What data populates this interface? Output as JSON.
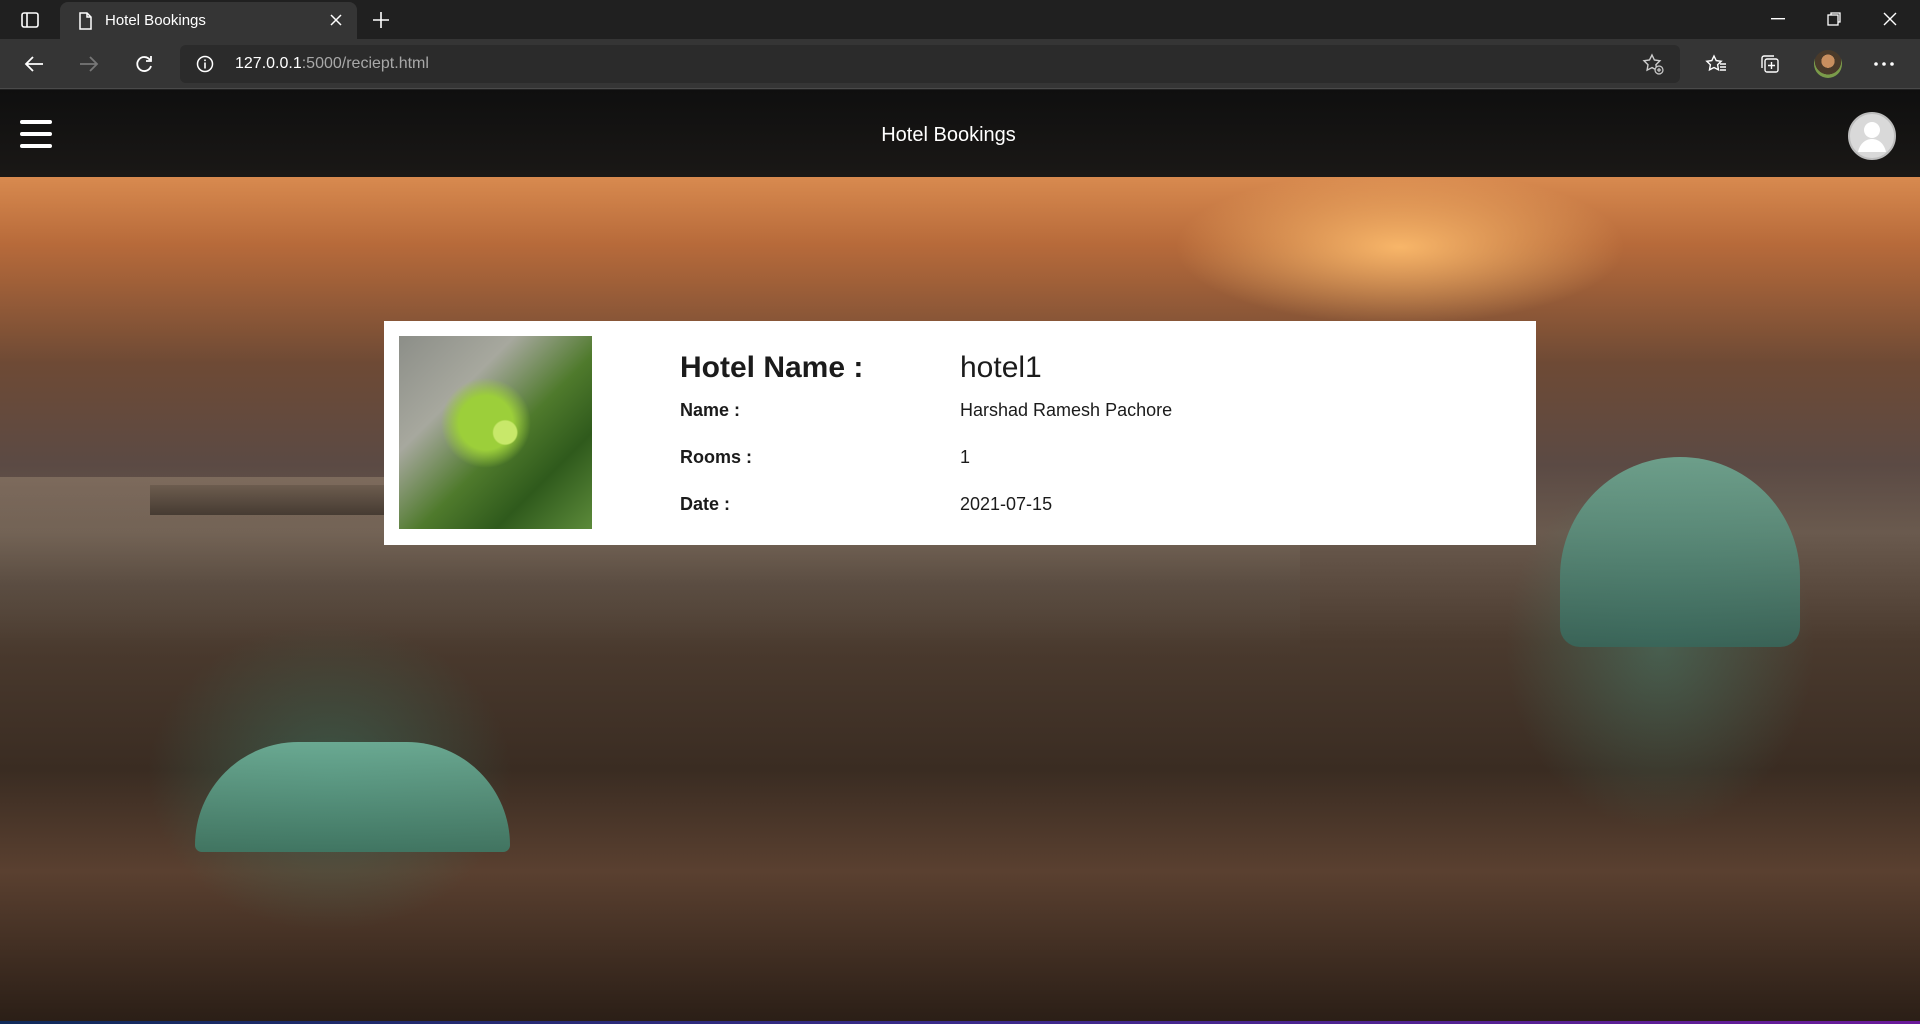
{
  "browser": {
    "tab_title": "Hotel Bookings",
    "url_host": "127.0.0.1",
    "url_rest": ":5000/reciept.html",
    "icons": {
      "tab_actions": "tab-actions-icon",
      "favicon": "page-icon",
      "close": "close-icon",
      "new_tab": "plus-icon",
      "back": "back-arrow-icon",
      "forward": "forward-arrow-icon",
      "refresh": "refresh-icon",
      "info": "info-icon",
      "add_favorite": "star-add-icon",
      "favorites": "favorites-icon",
      "collections": "collections-icon",
      "profile": "profile-avatar",
      "more": "more-icon",
      "minimize": "minimize-icon",
      "restore": "restore-icon",
      "close_window": "close-window-icon"
    }
  },
  "navbar": {
    "brand": "Hotel Bookings",
    "menu_icon": "hamburger-icon",
    "user_icon": "user-avatar-icon"
  },
  "receipt": {
    "hotel_label": "Hotel Name :",
    "hotel_value": "hotel1",
    "name_label": "Name :",
    "name_value": "Harshad Ramesh Pachore",
    "rooms_label": "Rooms :",
    "rooms_value": "1",
    "date_label": "Date :",
    "date_value": "2021-07-15"
  }
}
